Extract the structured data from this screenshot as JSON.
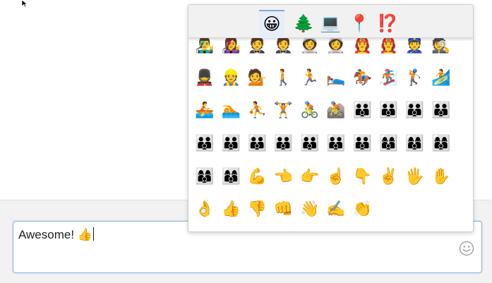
{
  "picker": {
    "tabs": [
      {
        "glyph": "😀",
        "name": "smileys-people",
        "active": true
      },
      {
        "glyph": "🌲",
        "name": "nature",
        "active": false
      },
      {
        "glyph": "💻",
        "name": "objects",
        "active": false
      },
      {
        "glyph": "📍",
        "name": "places",
        "active": false
      },
      {
        "glyph": "⁉️",
        "name": "symbols",
        "active": false
      }
    ],
    "rows": [
      [
        "👨‍🎤",
        "👩‍🎤",
        "🤵",
        "🤵",
        "👩‍🚀",
        "👩‍🚀",
        "👩‍🚒",
        "👩‍🚒",
        "👮",
        "🕵️"
      ],
      [
        "💂",
        "👷",
        "💁",
        "🚶",
        "🏃",
        "🛌",
        "🏇",
        "🏂",
        "🏌️",
        "🏄"
      ],
      [
        "🚣",
        "🏊",
        "⛹️",
        "🏋️",
        "🚴",
        "🚵",
        "👪",
        "👪",
        "👪",
        "👪"
      ],
      [
        "👪",
        "👪",
        "👨‍👨‍👦",
        "👨‍👨‍👦",
        "👨‍👨‍👦",
        "👨‍👨‍👦",
        "👨‍👨‍👦",
        "👩‍👩‍👦",
        "👩‍👩‍👦",
        "👩‍👩‍👦"
      ],
      [
        "👩‍👩‍👦",
        "👩‍👩‍👦",
        "💪",
        "👈",
        "👉",
        "☝️",
        "👇",
        "✌️",
        "🖐️",
        "✋"
      ],
      [
        "👌",
        "👍",
        "👎",
        "👊",
        "👋",
        "✍️",
        "👏"
      ]
    ]
  },
  "composer": {
    "text": "Awesome! 👍",
    "emoji_button_glyph": "☺"
  },
  "colors": {
    "focus_border": "#8ab4e6",
    "active_tab_border": "#7fa9d9",
    "band_background": "#f2f2f2"
  }
}
